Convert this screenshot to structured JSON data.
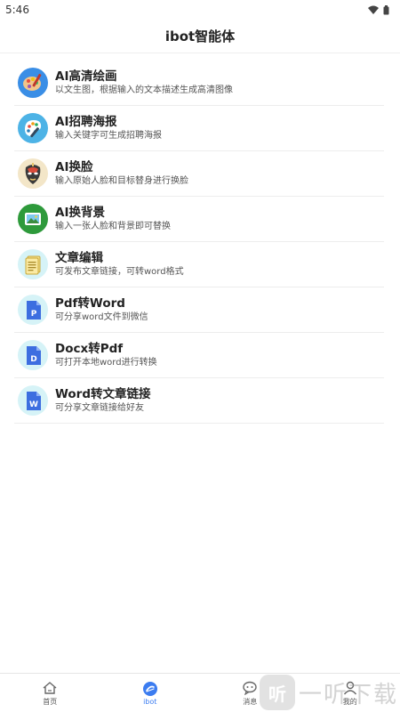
{
  "status_bar": {
    "time": "5:46"
  },
  "header": {
    "title": "ibot智能体"
  },
  "tools": [
    {
      "title": "AI高清绘画",
      "desc": "以文生图，根据输入的文本描述生成高清图像",
      "icon": "painting-palette-icon"
    },
    {
      "title": "AI招聘海报",
      "desc": "输入关键字可生成招聘海报",
      "icon": "palette-brush-icon"
    },
    {
      "title": "AI换脸",
      "desc": "输入原始人脸和目标替身进行换脸",
      "icon": "opera-mask-icon"
    },
    {
      "title": "AI换背景",
      "desc": "输入一张人脸和背景即可替换",
      "icon": "landscape-image-icon"
    },
    {
      "title": "文章编辑",
      "desc": "可发布文章链接，可转word格式",
      "icon": "document-edit-icon"
    },
    {
      "title": "Pdf转Word",
      "desc": "可分享word文件到微信",
      "icon": "file-p-icon"
    },
    {
      "title": "Docx转Pdf",
      "desc": "可打开本地word进行转换",
      "icon": "file-d-icon"
    },
    {
      "title": "Word转文章链接",
      "desc": "可分享文章链接给好友",
      "icon": "file-w-icon"
    }
  ],
  "tab_bar": {
    "tabs": [
      {
        "label": "首页",
        "icon": "home-icon"
      },
      {
        "label": "ibot",
        "icon": "ibot-icon",
        "active": true
      },
      {
        "label": "消息",
        "icon": "message-icon"
      },
      {
        "label": "我的",
        "icon": "user-icon"
      }
    ]
  },
  "watermark": {
    "mark": "听",
    "text": "一听下载"
  },
  "colors": {
    "accent": "#3b7cf0",
    "divider": "#ededed"
  }
}
